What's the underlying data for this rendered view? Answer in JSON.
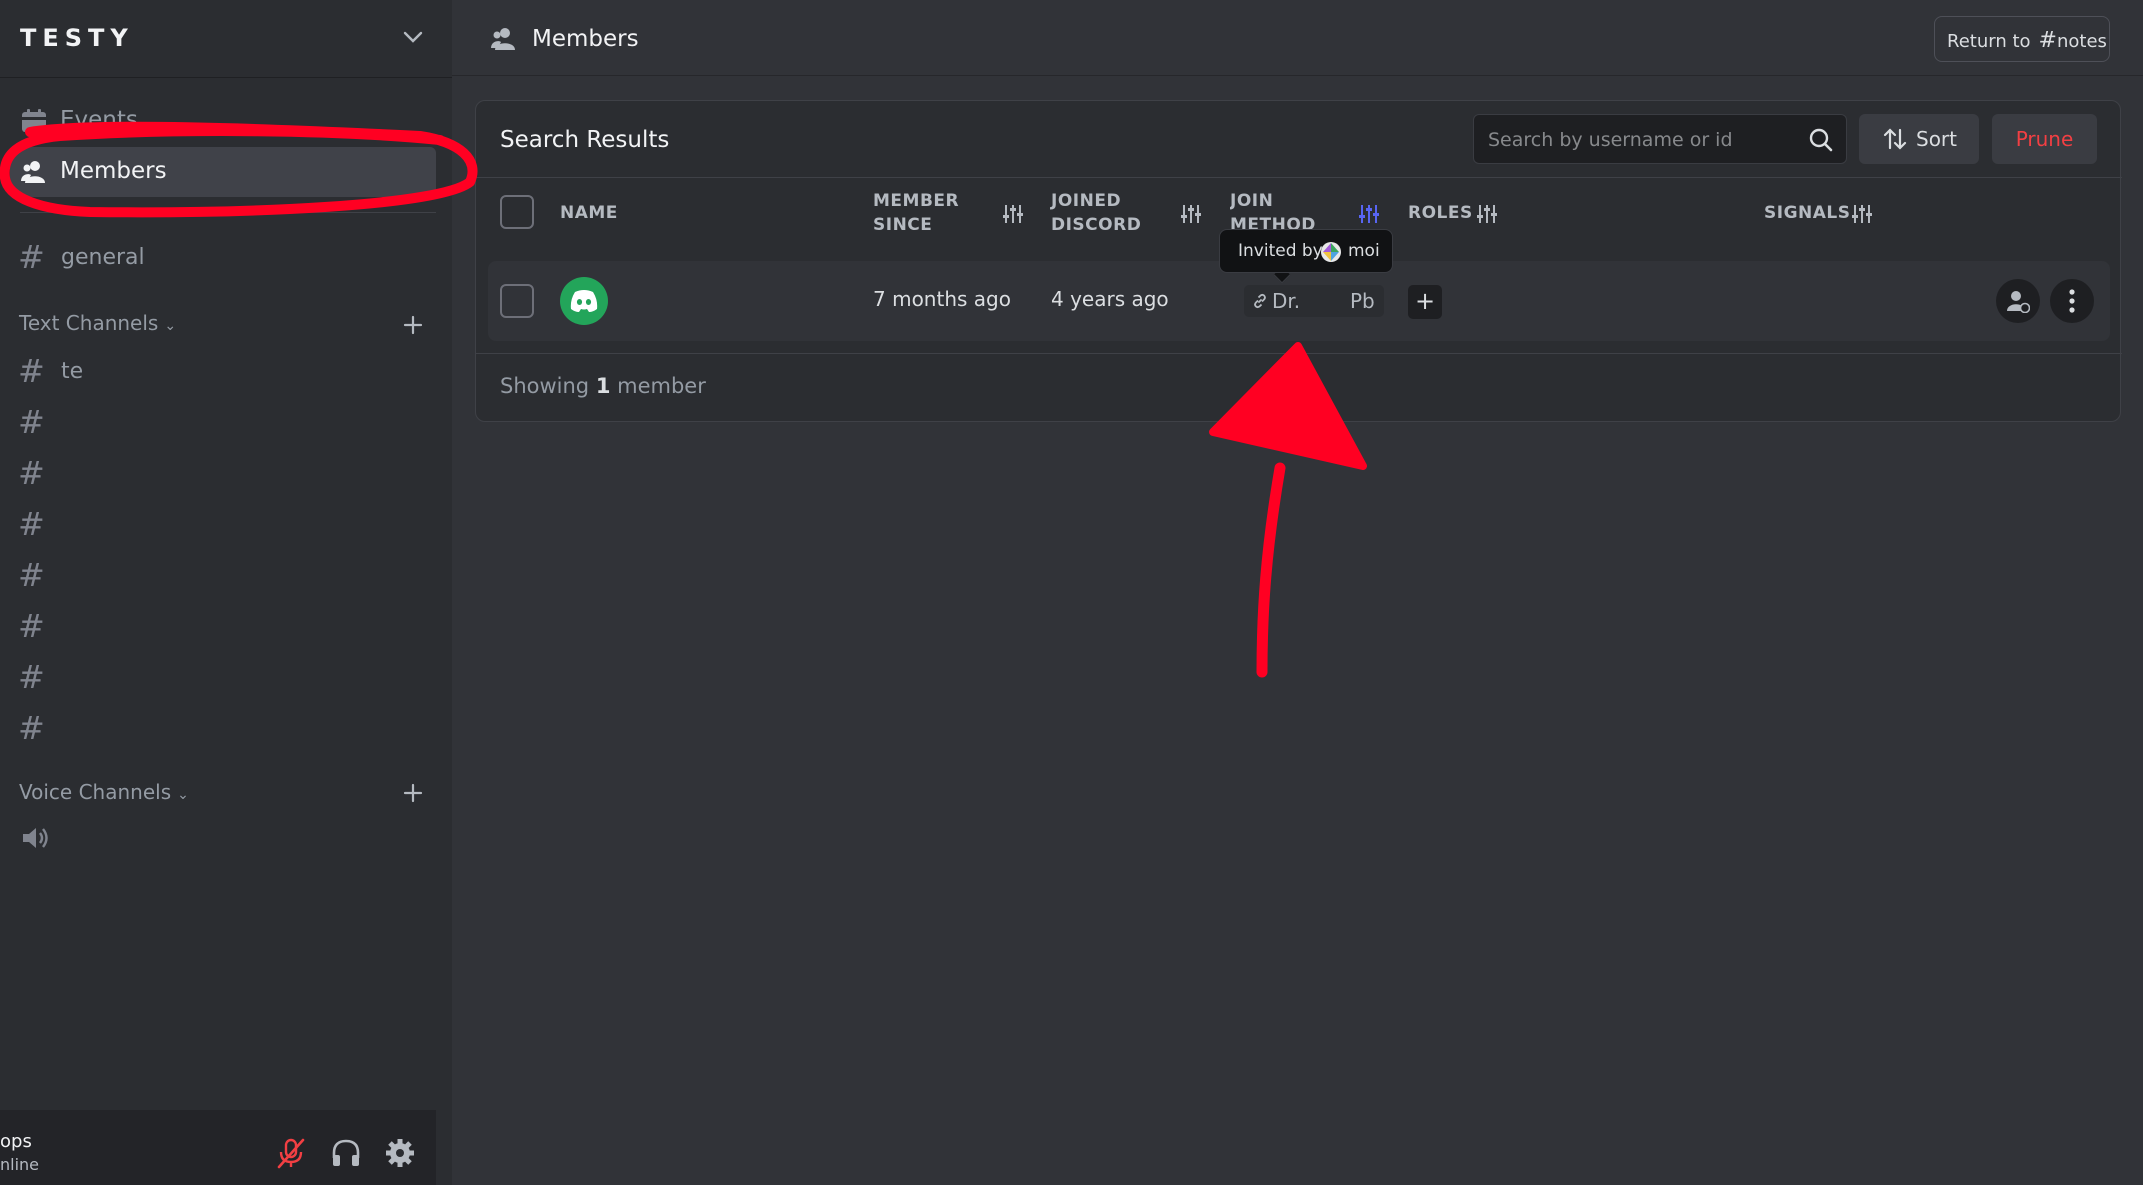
{
  "server": {
    "name": "TESTY"
  },
  "sidebar": {
    "events_label": "Events",
    "members_label": "Members",
    "general_label": "general",
    "text_category": "Text Channels",
    "text_channels": [
      "te",
      "",
      "",
      "",
      "",
      "",
      "",
      ""
    ],
    "voice_category": "Voice Channels",
    "voice_channels": [
      ""
    ]
  },
  "user_panel": {
    "name": "ops",
    "status": "nline"
  },
  "topbar": {
    "title": "Members",
    "return_label": "Return to",
    "return_channel": "notes"
  },
  "panel": {
    "title": "Search Results",
    "search_placeholder": "Search by username or id",
    "sort_label": "Sort",
    "prune_label": "Prune",
    "columns": {
      "name": "NAME",
      "member_since": "MEMBER SINCE",
      "joined_discord": "JOINED DISCORD",
      "join_method": "JOIN METHOD",
      "roles": "ROLES",
      "signals": "SIGNALS"
    },
    "rows": [
      {
        "member_since": "7 months ago",
        "joined_discord": "4 years ago",
        "invite_code_start": "Dr.",
        "invite_code_end": "Pb"
      }
    ],
    "tooltip": {
      "prefix": "Invited by",
      "inviter": "moi"
    },
    "footer": {
      "prefix": "Showing",
      "count": "1",
      "suffix": "member"
    },
    "add_role_label": "+"
  },
  "colors": {
    "annotation": "#ff0022",
    "accent": "#5865f2",
    "danger": "#f23f43",
    "online_avatar": "#23a55a"
  }
}
